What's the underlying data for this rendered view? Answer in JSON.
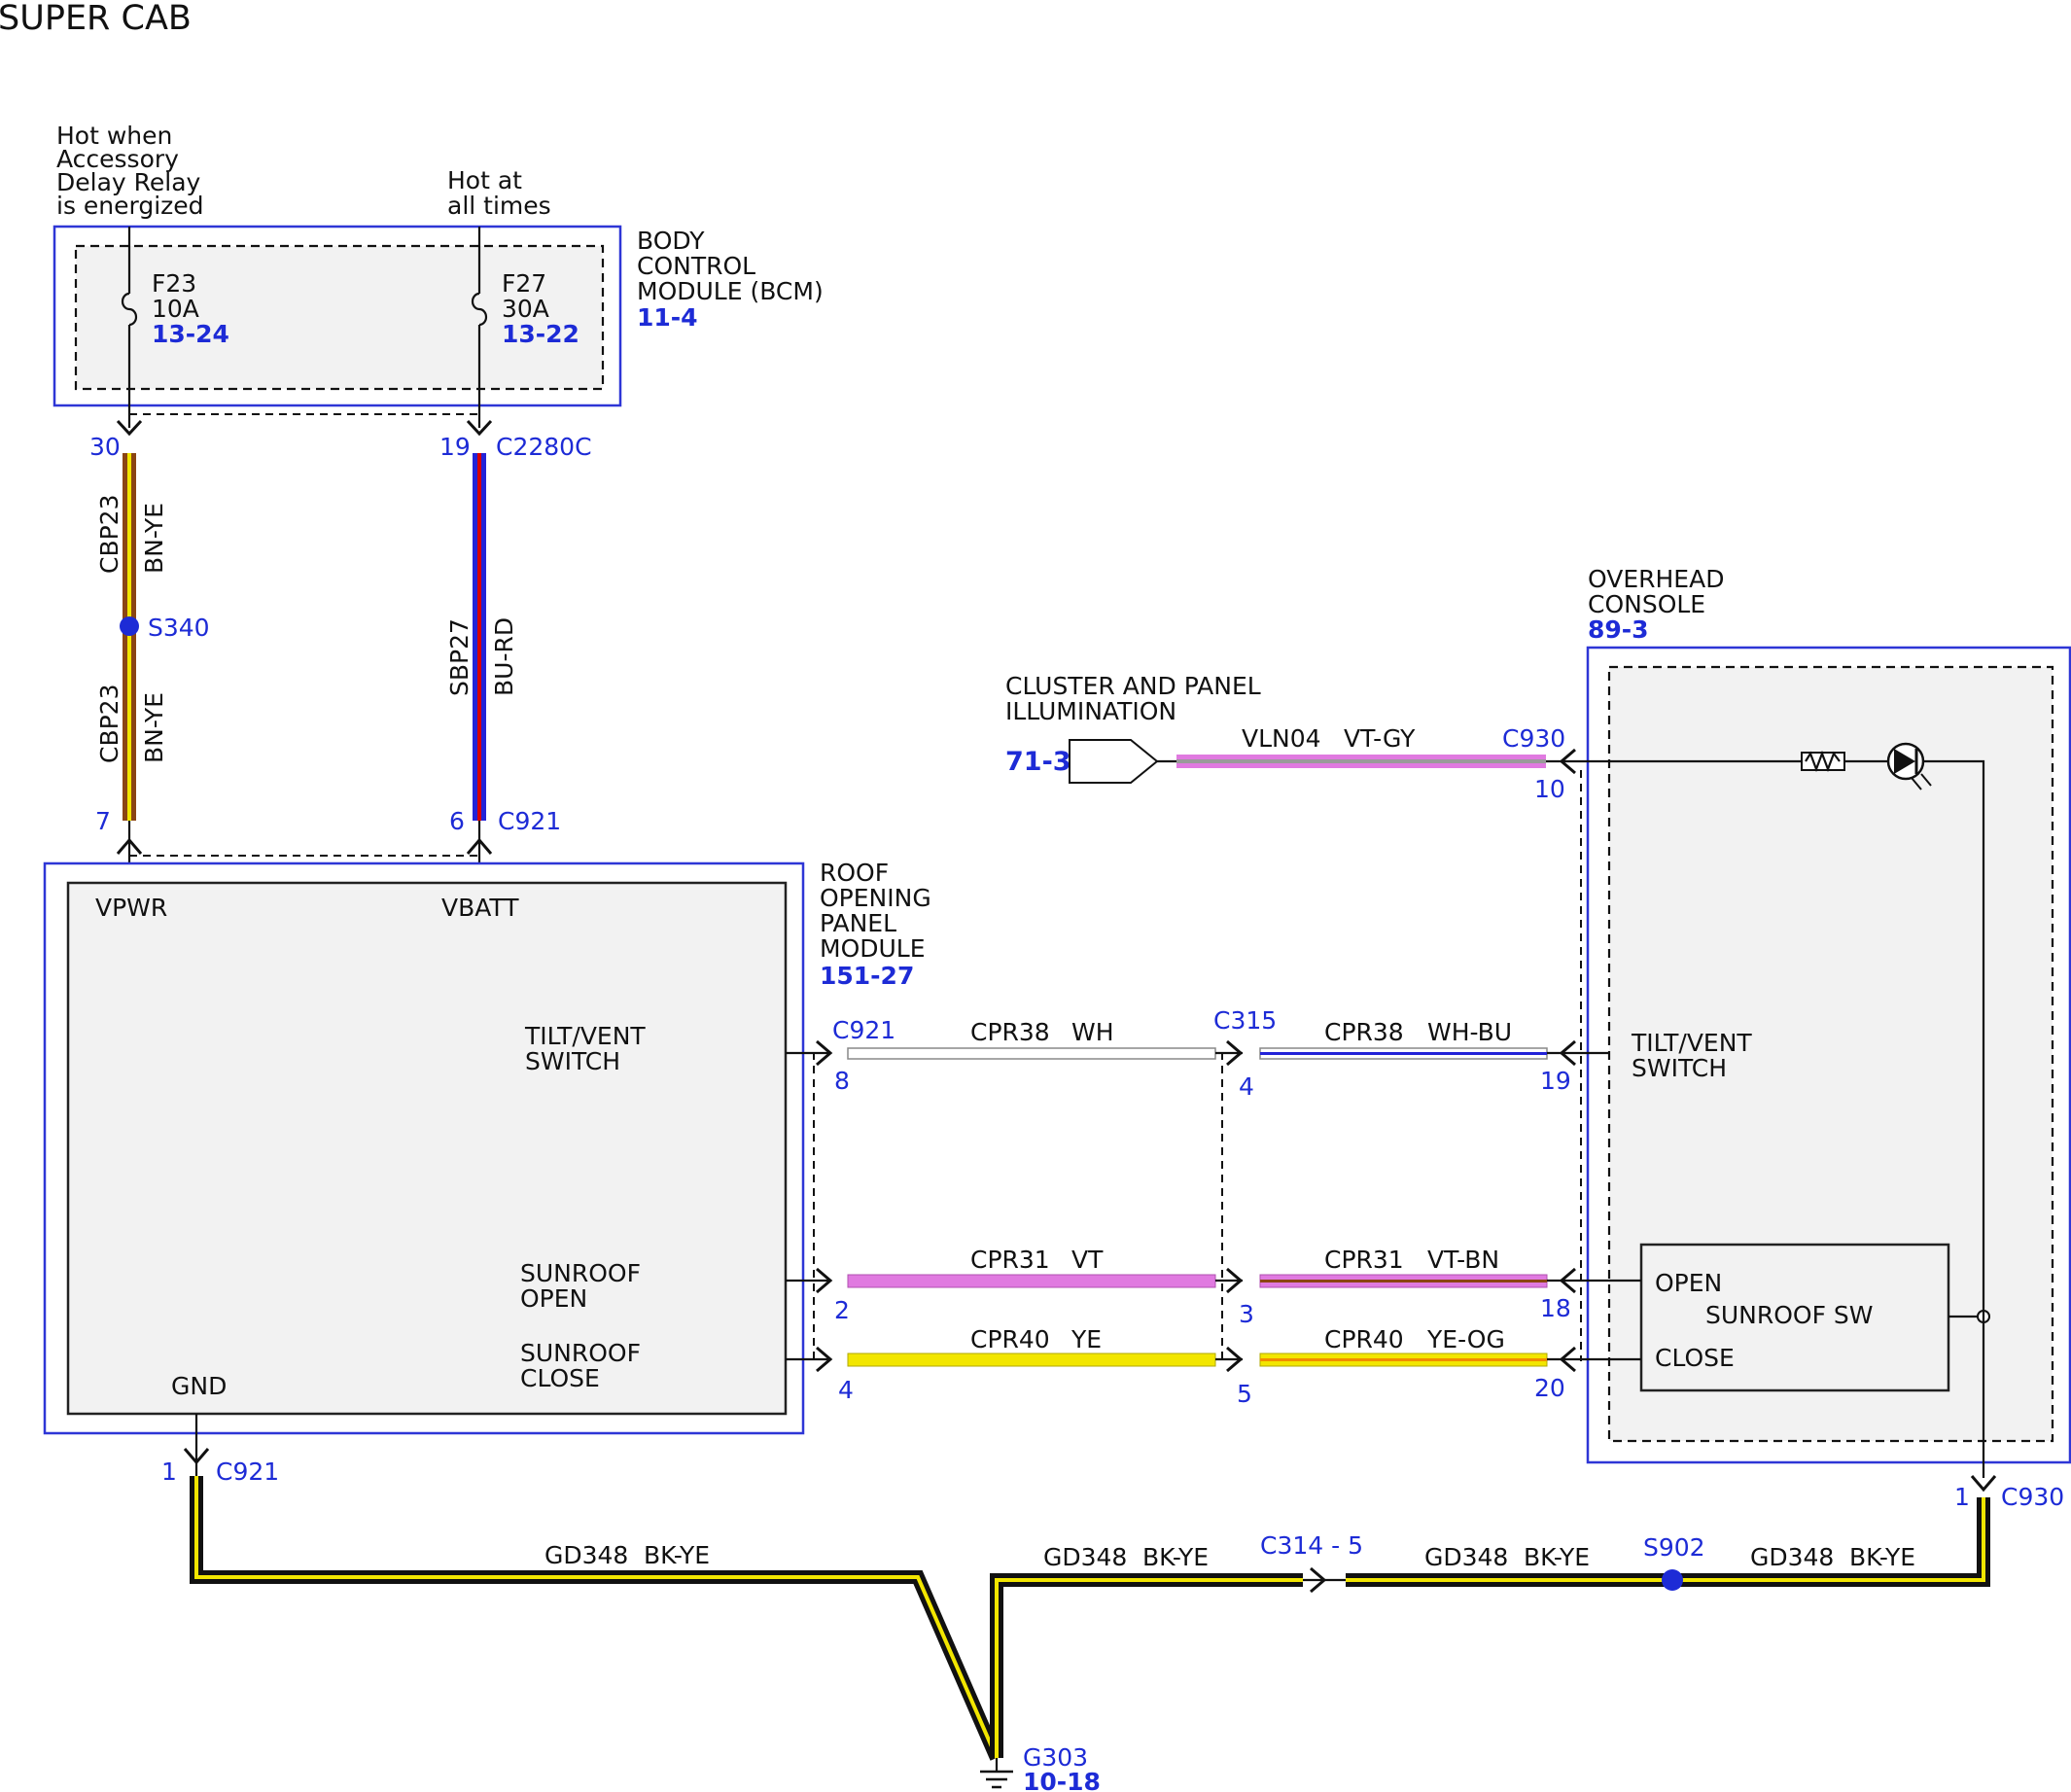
{
  "page_title": "SUPER CAB",
  "colors": {
    "BK": "#111111",
    "YE": "#f2e600",
    "BN": "#8b4513",
    "BU": "#2323d8",
    "RD": "#d60000",
    "VT": "#e07ae0",
    "GY": "#9a9a9a",
    "WH": "#ffffff",
    "OG": "#f28c00",
    "ref_blue": "#1d2bd6",
    "box_border": "#2e36d6"
  },
  "power_sources": {
    "acc": {
      "lines": [
        "Hot when",
        "Accessory",
        "Delay Relay",
        "is energized"
      ]
    },
    "batt": {
      "lines": [
        "Hot at",
        "all times"
      ]
    }
  },
  "bcm": {
    "name_lines": [
      "BODY",
      "CONTROL",
      "MODULE (BCM)"
    ],
    "ref": "11-4",
    "fuses": [
      {
        "id": "F23",
        "rating": "10A",
        "ref": "13-24"
      },
      {
        "id": "F27",
        "rating": "30A",
        "ref": "13-22"
      }
    ]
  },
  "roof_module": {
    "name_lines": [
      "ROOF",
      "OPENING",
      "PANEL",
      "MODULE"
    ],
    "ref": "151-27",
    "pins": {
      "vpwr": "VPWR",
      "vbatt": "VBATT",
      "gnd": "GND",
      "tilt": [
        "TILT/VENT",
        "SWITCH"
      ],
      "open": [
        "SUNROOF",
        "OPEN"
      ],
      "close": [
        "SUNROOF",
        "CLOSE"
      ]
    }
  },
  "overhead_console": {
    "name_lines": [
      "OVERHEAD",
      "CONSOLE"
    ],
    "ref": "89-3",
    "tilt": [
      "TILT/VENT",
      "SWITCH"
    ],
    "switch": {
      "name": "SUNROOF SW",
      "open": "OPEN",
      "close": "CLOSE"
    }
  },
  "illumination": {
    "name_lines": [
      "CLUSTER AND PANEL",
      "ILLUMINATION"
    ],
    "ref": "71-3"
  },
  "ground": {
    "id": "G303",
    "ref": "10-18"
  },
  "splices": {
    "s340": "S340",
    "s902": "S902"
  },
  "connectors": {
    "c2280c": "C2280C",
    "c921": "C921",
    "c921_gnd": "C921",
    "c921_sig": "C921",
    "c315": "C315",
    "c930": "C930",
    "c930_gnd": "C930",
    "c314": "C314 - 5"
  },
  "pins": {
    "p30": "30",
    "p19": "19",
    "p7": "7",
    "p6": "6",
    "p8": "8",
    "p4a": "4",
    "p19b": "19",
    "p2": "2",
    "p3": "3",
    "p18": "18",
    "p4b": "4",
    "p5": "5",
    "p20": "20",
    "p1a": "1",
    "p1b": "1",
    "p10": "10"
  },
  "wires": {
    "cbp23_top": {
      "circuit": "CBP23",
      "color": "BN-YE"
    },
    "cbp23_bot": {
      "circuit": "CBP23",
      "color": "BN-YE"
    },
    "sbp27": {
      "circuit": "SBP27",
      "color": "BU-RD"
    },
    "vln04": {
      "circuit": "VLN04",
      "color": "VT-GY"
    },
    "cpr38_a": {
      "circuit": "CPR38",
      "color": "WH"
    },
    "cpr38_b": {
      "circuit": "CPR38",
      "color": "WH-BU"
    },
    "cpr31_a": {
      "circuit": "CPR31",
      "color": "VT"
    },
    "cpr31_b": {
      "circuit": "CPR31",
      "color": "VT-BN"
    },
    "cpr40_a": {
      "circuit": "CPR40",
      "color": "YE"
    },
    "cpr40_b": {
      "circuit": "CPR40",
      "color": "YE-OG"
    },
    "gd348_1": {
      "circuit": "GD348",
      "color": "BK-YE"
    },
    "gd348_2": {
      "circuit": "GD348",
      "color": "BK-YE"
    },
    "gd348_3": {
      "circuit": "GD348",
      "color": "BK-YE"
    },
    "gd348_4": {
      "circuit": "GD348",
      "color": "BK-YE"
    }
  }
}
